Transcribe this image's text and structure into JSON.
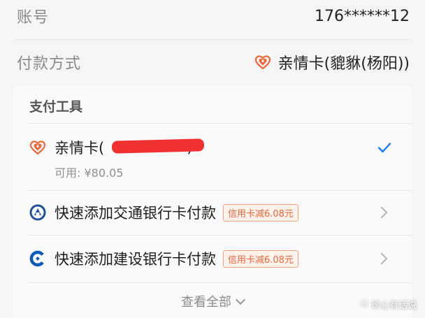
{
  "account": {
    "label": "账号",
    "value": "176******12"
  },
  "payment_method": {
    "label": "付款方式",
    "value": "亲情卡(貔貅(杨阳))",
    "icon": "family-card-heart-icon"
  },
  "tools": {
    "title": "支付工具",
    "items": [
      {
        "name": "亲情卡(",
        "name_suffix": ")",
        "sub": "可用: ¥80.05",
        "icon": "family-card-heart-icon",
        "selected": true
      },
      {
        "name": "快速添加交通银行卡付款",
        "promo": "信用卡减6.08元",
        "icon": "bank-of-communications-icon"
      },
      {
        "name": "快速添加建设银行卡付款",
        "promo": "信用卡减6.08元",
        "icon": "china-construction-bank-icon"
      }
    ],
    "view_all": "查看全部"
  },
  "watermark": "珍心有话说",
  "colors": {
    "accent_blue": "#1777ff",
    "heart_orange": "#e9673a",
    "promo_orange": "#e8643c",
    "redaction_red": "#f03131",
    "comm_bank_blue": "#1f4e9c",
    "ccb_blue": "#0b5ab8"
  }
}
